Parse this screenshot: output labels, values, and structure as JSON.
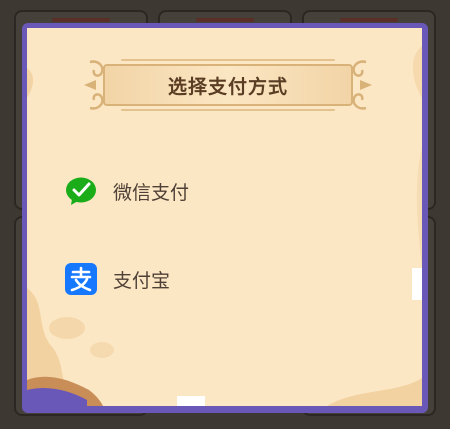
{
  "dialog": {
    "title": "选择支付方式",
    "options": [
      {
        "id": "wechat",
        "label": "微信支付",
        "icon": "wechat-pay-icon",
        "color": "#1aad19"
      },
      {
        "id": "alipay",
        "label": "支付宝",
        "icon": "alipay-icon",
        "color": "#1677ff"
      }
    ]
  },
  "colors": {
    "frame": "#6a58b8",
    "panel": "#fce7c4",
    "banner_border": "#d9b27a",
    "title_text": "#5b3d24",
    "option_text": "#4f4037",
    "backdrop": "#3e3833"
  }
}
